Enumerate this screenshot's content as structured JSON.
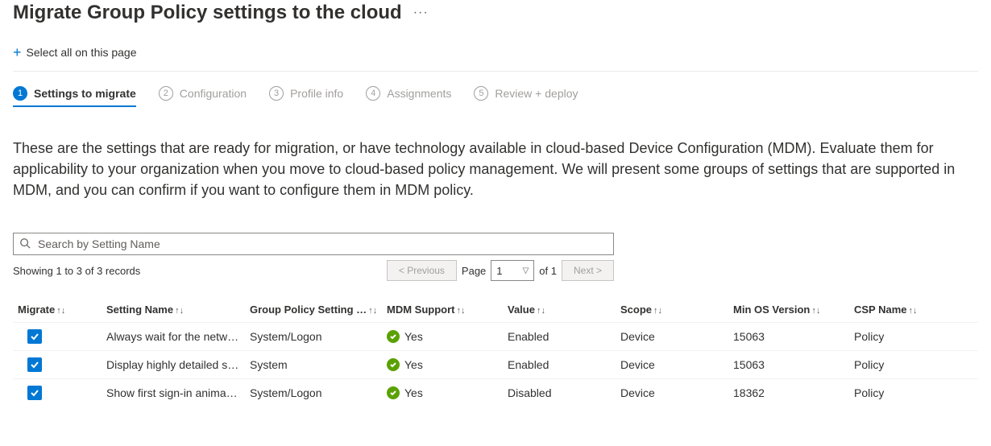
{
  "header": {
    "title": "Migrate Group Policy settings to the cloud",
    "ellipsis": "···"
  },
  "toolbar": {
    "select_all": "Select all on this page"
  },
  "wizard": {
    "steps": [
      {
        "num": "1",
        "label": "Settings to migrate"
      },
      {
        "num": "2",
        "label": "Configuration"
      },
      {
        "num": "3",
        "label": "Profile info"
      },
      {
        "num": "4",
        "label": "Assignments"
      },
      {
        "num": "5",
        "label": "Review + deploy"
      }
    ]
  },
  "intro": "These are the settings that are ready for migration, or have technology available in cloud-based Device Configuration (MDM). Evaluate them for applicability to your organization when you move to cloud-based policy management. We will present some groups of settings that are supported in MDM, and you can confirm if you want to configure them in MDM policy.",
  "search": {
    "placeholder": "Search by Setting Name"
  },
  "records": {
    "text": "Showing 1 to 3 of 3 records",
    "prev": "< Previous",
    "next": "Next >",
    "page_label": "Page",
    "page_value": "1",
    "of_text": "of 1"
  },
  "columns": {
    "migrate": "Migrate",
    "setting_name": "Setting Name",
    "gp_path": "Group Policy Setting …",
    "mdm_support": "MDM Support",
    "value": "Value",
    "scope": "Scope",
    "min_os": "Min OS Version",
    "csp": "CSP Name"
  },
  "rows": [
    {
      "checked": true,
      "setting_name": "Always wait for the networ…",
      "gp_path": "System/Logon",
      "mdm_support": "Yes",
      "value": "Enabled",
      "scope": "Device",
      "min_os": "15063",
      "csp": "Policy"
    },
    {
      "checked": true,
      "setting_name": "Display highly detailed stat…",
      "gp_path": "System",
      "mdm_support": "Yes",
      "value": "Enabled",
      "scope": "Device",
      "min_os": "15063",
      "csp": "Policy"
    },
    {
      "checked": true,
      "setting_name": "Show first sign-in animation",
      "gp_path": "System/Logon",
      "mdm_support": "Yes",
      "value": "Disabled",
      "scope": "Device",
      "min_os": "18362",
      "csp": "Policy"
    }
  ],
  "sort_glyph": "↑↓"
}
